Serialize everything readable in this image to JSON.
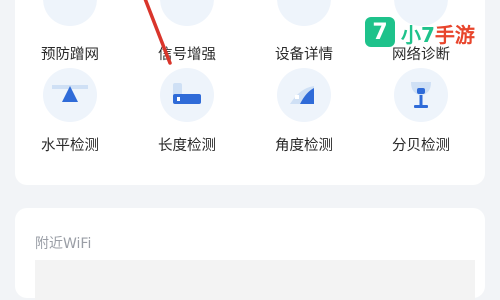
{
  "tools": {
    "row1": [
      {
        "label": "预防蹭网",
        "icon": "anti-freeload-icon"
      },
      {
        "label": "信号增强",
        "icon": "signal-boost-icon"
      },
      {
        "label": "设备详情",
        "icon": "device-details-icon"
      },
      {
        "label": "网络诊断",
        "icon": "network-diagnosis-icon"
      }
    ],
    "row2": [
      {
        "label": "水平检测",
        "icon": "level-detection-icon"
      },
      {
        "label": "长度检测",
        "icon": "length-detection-icon"
      },
      {
        "label": "角度检测",
        "icon": "angle-detection-icon"
      },
      {
        "label": "分贝检测",
        "icon": "decibel-detection-icon"
      }
    ]
  },
  "wifi_section": {
    "title": "附近WiFi"
  },
  "watermark": {
    "badge": "7",
    "text_green": "小7",
    "text_red": "手游"
  },
  "colors": {
    "icon_blue": "#2f6bd8",
    "icon_bg": "#eef4fb",
    "arrow_red": "#d9352b",
    "watermark_green": "#1ec28b",
    "watermark_red": "#e8452c"
  }
}
